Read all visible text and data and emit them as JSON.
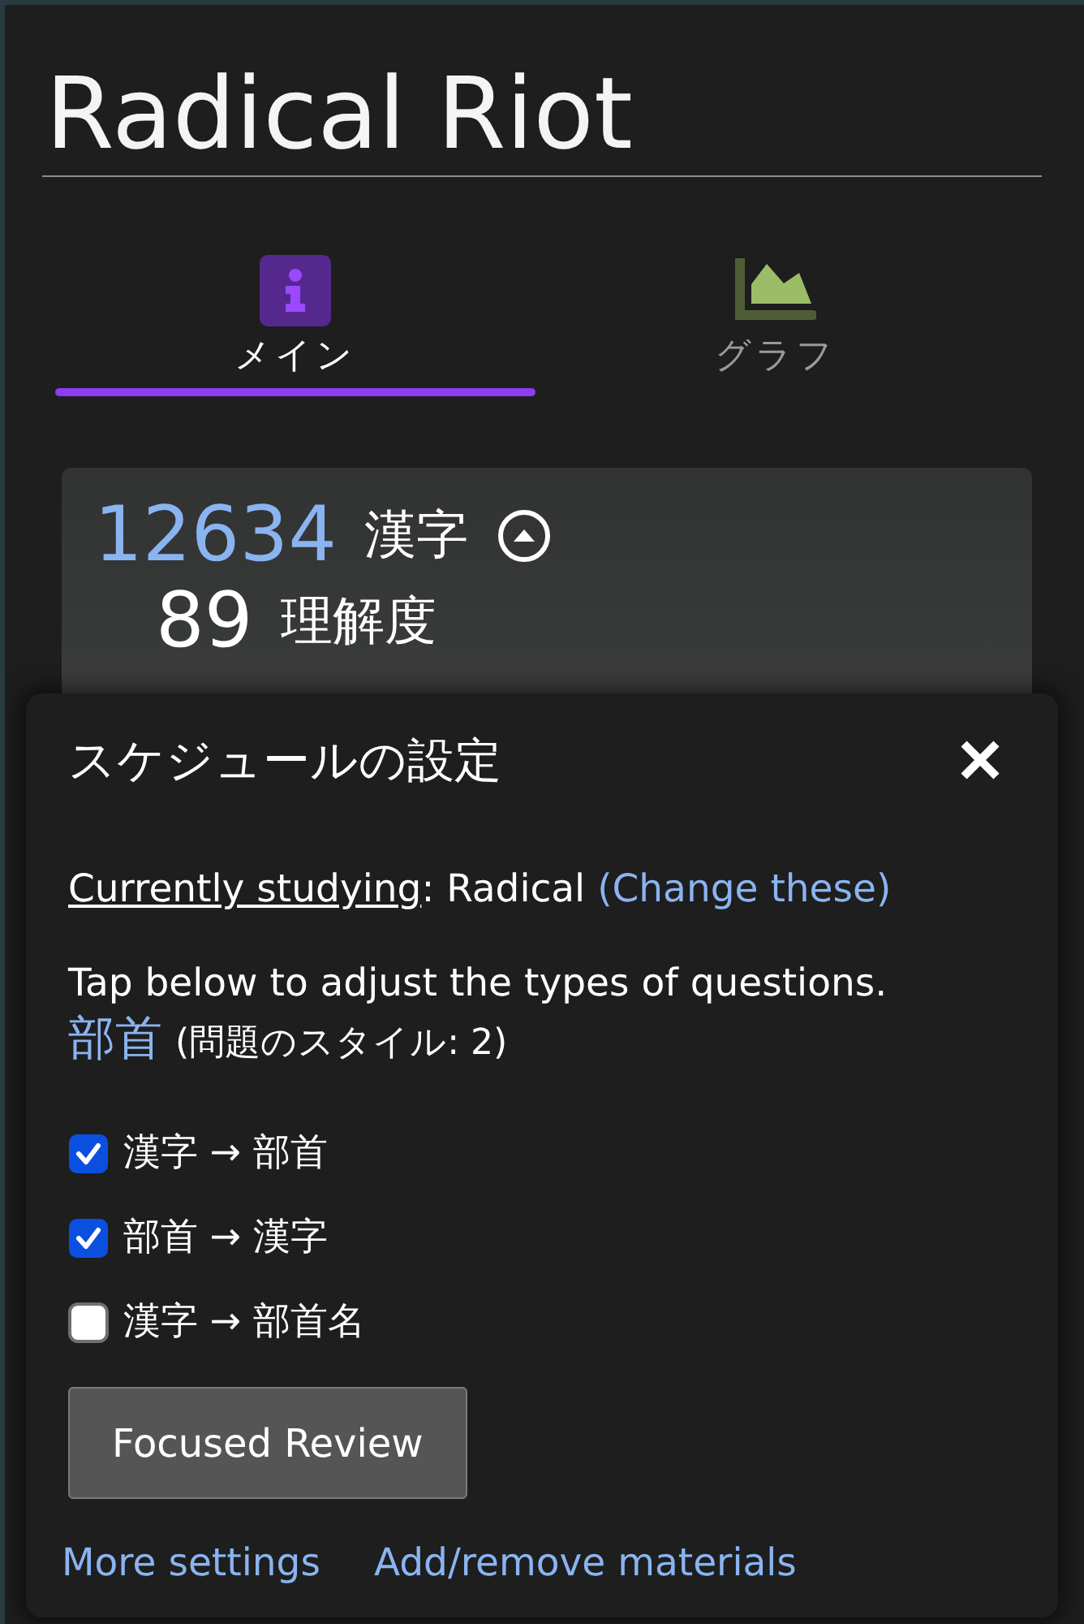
{
  "app": {
    "title": "Radical Riot"
  },
  "tabs": [
    {
      "kind": "info",
      "label": "メイン",
      "selected": true
    },
    {
      "kind": "chart",
      "label": "グラフ",
      "selected": false
    }
  ],
  "summary": {
    "count": "12634",
    "count_label": "漢字",
    "score": "89",
    "score_label": "理解度"
  },
  "dialog": {
    "title": "スケジュールの設定",
    "studying": {
      "term": "Currently studying",
      "text": ": Radical",
      "link": "(Change these)"
    },
    "instruction": "Tap below to adjust the types of questions.",
    "question_type": {
      "name": "部首",
      "detail": "(問題のスタイル: 2)"
    },
    "options": [
      {
        "label": "漢字 → 部首",
        "checked": true
      },
      {
        "label": "部首 → 漢字",
        "checked": true
      },
      {
        "label": "漢字 → 部首名",
        "checked": false
      }
    ],
    "button": {
      "label": "Focused Review"
    },
    "links": [
      "More settings",
      "Add/remove materials"
    ]
  }
}
